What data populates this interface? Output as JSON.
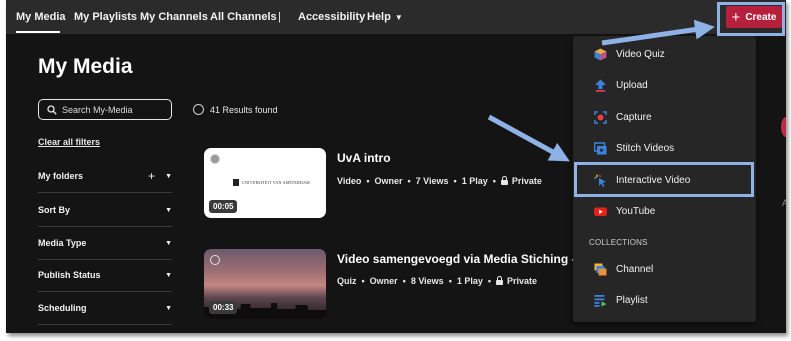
{
  "nav": {
    "items": [
      "My Media",
      "My Playlists",
      "My Channels",
      "All Channels",
      "|",
      "Accessibility",
      "Help"
    ],
    "create_label": "Create"
  },
  "page": {
    "title": "My Media",
    "search_placeholder": "Search My-Media",
    "results_text": "41 Results found",
    "clear_filters": "Clear all filters"
  },
  "filters": [
    "My folders",
    "Sort By",
    "Media Type",
    "Publish Status",
    "Scheduling"
  ],
  "media": [
    {
      "title": "UvA intro",
      "duration": "00:05",
      "type": "Video",
      "role": "Owner",
      "views": "7 Views",
      "plays": "1 Play",
      "privacy": "Private",
      "thumb_text": "UNIVERSITEIT VAN AMSTERDAM"
    },
    {
      "title": "Video samengevoegd via Media Stiching - Qu",
      "duration": "00:33",
      "type": "Quiz",
      "role": "Owner",
      "views": "8 Views",
      "plays": "1 Play",
      "privacy": "Private"
    }
  ],
  "create_menu": {
    "items": [
      {
        "label": "Video Quiz",
        "icon": "video-quiz-icon"
      },
      {
        "label": "Upload",
        "icon": "upload-icon"
      },
      {
        "label": "Capture",
        "icon": "capture-icon"
      },
      {
        "label": "Stitch Videos",
        "icon": "stitch-icon"
      },
      {
        "label": "Interactive Video",
        "icon": "interactive-video-icon"
      },
      {
        "label": "YouTube",
        "icon": "youtube-icon"
      }
    ],
    "collections_heading": "COLLECTIONS",
    "collection_items": [
      {
        "label": "Channel",
        "icon": "channel-icon"
      },
      {
        "label": "Playlist",
        "icon": "playlist-icon"
      }
    ]
  },
  "colors": {
    "create_button": "#b5203c",
    "annotation": "#8fb2e6",
    "background": "#141414"
  },
  "edge_glyph": "A"
}
